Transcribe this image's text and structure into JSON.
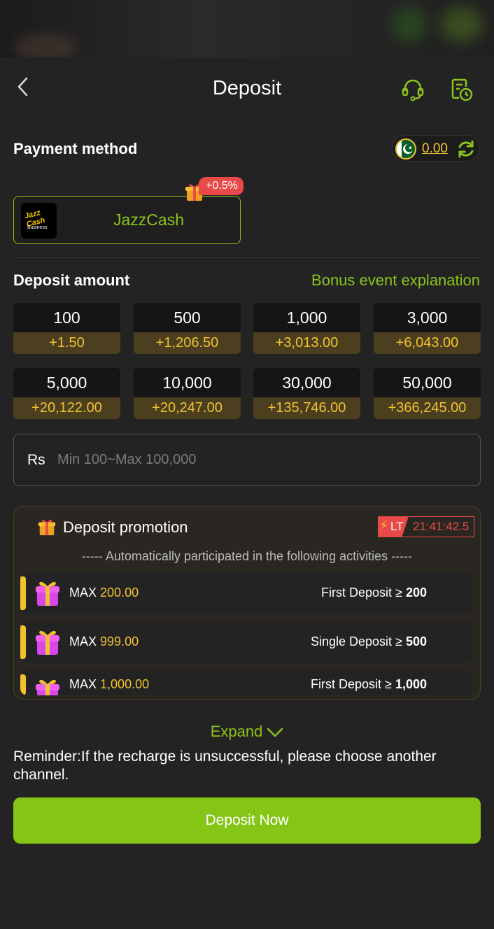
{
  "header": {
    "title": "Deposit"
  },
  "payment": {
    "label": "Payment method",
    "balance": "0.00",
    "methods": [
      {
        "name": "JazzCash",
        "logo_text": "Jazz Cash",
        "logo_sub": "Business",
        "bonus": "+0.5%"
      }
    ]
  },
  "deposit": {
    "label": "Deposit amount",
    "bonus_link": "Bonus event explanation",
    "amounts": [
      {
        "value": "100",
        "bonus": "+1.50"
      },
      {
        "value": "500",
        "bonus": "+1,206.50"
      },
      {
        "value": "1,000",
        "bonus": "+3,013.00"
      },
      {
        "value": "3,000",
        "bonus": "+6,043.00"
      },
      {
        "value": "5,000",
        "bonus": "+20,122.00"
      },
      {
        "value": "10,000",
        "bonus": "+20,247.00"
      },
      {
        "value": "30,000",
        "bonus": "+135,746.00"
      },
      {
        "value": "50,000",
        "bonus": "+366,245.00"
      }
    ],
    "currency": "Rs",
    "placeholder": "Min 100~Max 100,000"
  },
  "promotion": {
    "title": "Deposit promotion",
    "lt_label": "LT",
    "countdown": "21:41:42.5",
    "subtitle": "----- Automatically participated in the following activities -----",
    "items": [
      {
        "max_label": "MAX",
        "max_value": "200.00",
        "cond_label": "First Deposit ≥",
        "cond_value": "200"
      },
      {
        "max_label": "MAX",
        "max_value": "999.00",
        "cond_label": "Single Deposit ≥",
        "cond_value": "500"
      },
      {
        "max_label": "MAX",
        "max_value": "1,000.00",
        "cond_label": "First Deposit ≥",
        "cond_value": "1,000"
      }
    ],
    "expand_label": "Expand"
  },
  "reminder": "Reminder:If the recharge is unsuccessful, please choose another channel.",
  "cta": {
    "label": "Deposit Now"
  },
  "colors": {
    "accent": "#84c515",
    "gold": "#f2c230",
    "danger": "#e84a4a",
    "background": "#232323"
  }
}
